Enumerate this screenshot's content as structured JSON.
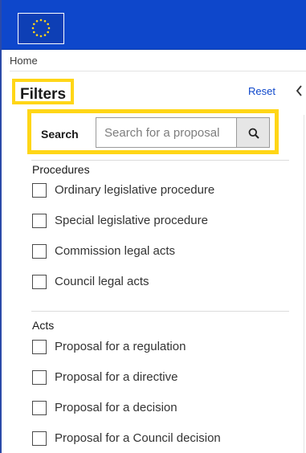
{
  "header": {
    "logo_icon": "eu-flag-icon",
    "brand_color": "#0e47cb",
    "highlight_color": "#ffd617"
  },
  "breadcrumb": {
    "home": "Home"
  },
  "filters": {
    "title": "Filters",
    "reset_label": "Reset",
    "collapse_icon": "chevron-left-icon"
  },
  "search": {
    "label": "Search",
    "placeholder": "Search for a proposal",
    "value": "",
    "button_icon": "search-icon"
  },
  "procedures": {
    "title": "Procedures",
    "items": [
      {
        "label": "Ordinary legislative procedure",
        "checked": false
      },
      {
        "label": "Special legislative procedure",
        "checked": false
      },
      {
        "label": "Commission legal acts",
        "checked": false
      },
      {
        "label": "Council legal acts",
        "checked": false
      }
    ]
  },
  "acts": {
    "title": "Acts",
    "items": [
      {
        "label": "Proposal for a regulation",
        "checked": false
      },
      {
        "label": "Proposal for a directive",
        "checked": false
      },
      {
        "label": "Proposal for a decision",
        "checked": false
      },
      {
        "label": "Proposal for a Council decision",
        "checked": false
      }
    ]
  }
}
